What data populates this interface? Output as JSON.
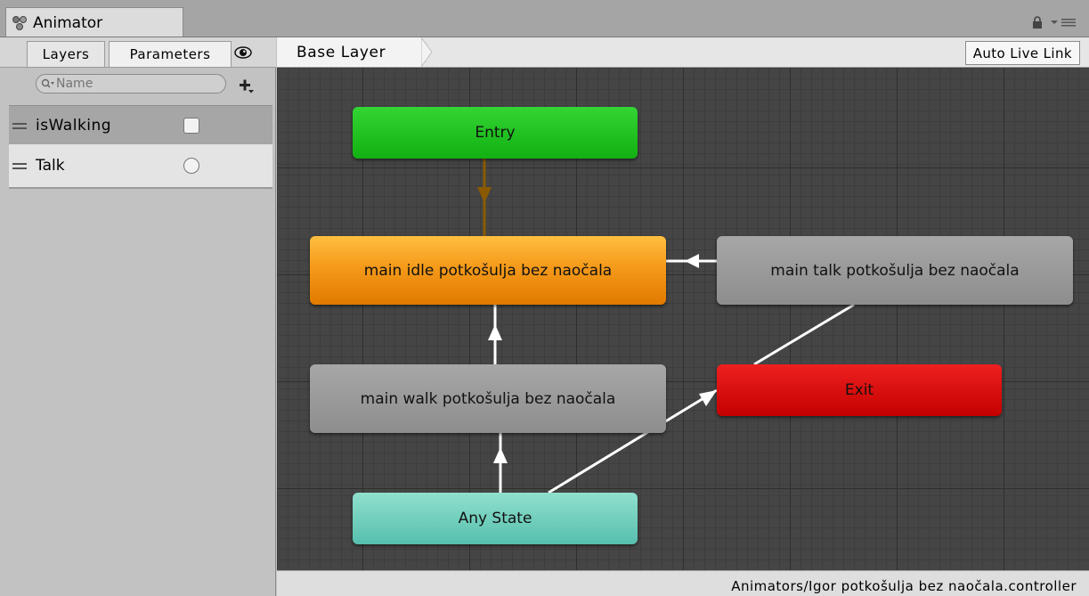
{
  "window": {
    "tab_title": "Animator",
    "tab_icon": "animator-icon",
    "lock_icon": "lock-icon",
    "menu_icon": "context-menu-icon"
  },
  "left_panel": {
    "tabs": [
      {
        "label": "Layers",
        "active": false
      },
      {
        "label": "Parameters",
        "active": true
      }
    ],
    "eye_icon": "eye-icon",
    "search": {
      "placeholder": "Name",
      "value": ""
    },
    "add_icon": "plus-icon",
    "parameters": [
      {
        "name": "isWalking",
        "type": "bool",
        "selected": true
      },
      {
        "name": "Talk",
        "type": "trigger",
        "selected": false
      }
    ]
  },
  "graph_toolbar": {
    "breadcrumb": "Base Layer",
    "auto_live_link": "Auto Live Link"
  },
  "graph": {
    "nodes": {
      "entry": {
        "label": "Entry",
        "color": "#1fc41f"
      },
      "idle": {
        "label": "main idle potkošulja bez naočala",
        "color": "#f59a1a"
      },
      "talk": {
        "label": "main talk potkošulja bez naočala",
        "color": "#9a9a9a"
      },
      "walk": {
        "label": "main walk potkošulja bez naočala",
        "color": "#9a9a9a"
      },
      "exit": {
        "label": "Exit",
        "color": "#d80a0a"
      },
      "any": {
        "label": "Any State",
        "color": "#72cfbd"
      }
    },
    "transition_colors": {
      "default": "#ffffff",
      "entry": "#8a5a00"
    }
  },
  "status_bar": {
    "path": "Animators/Igor potkošulja bez naočala.controller"
  }
}
